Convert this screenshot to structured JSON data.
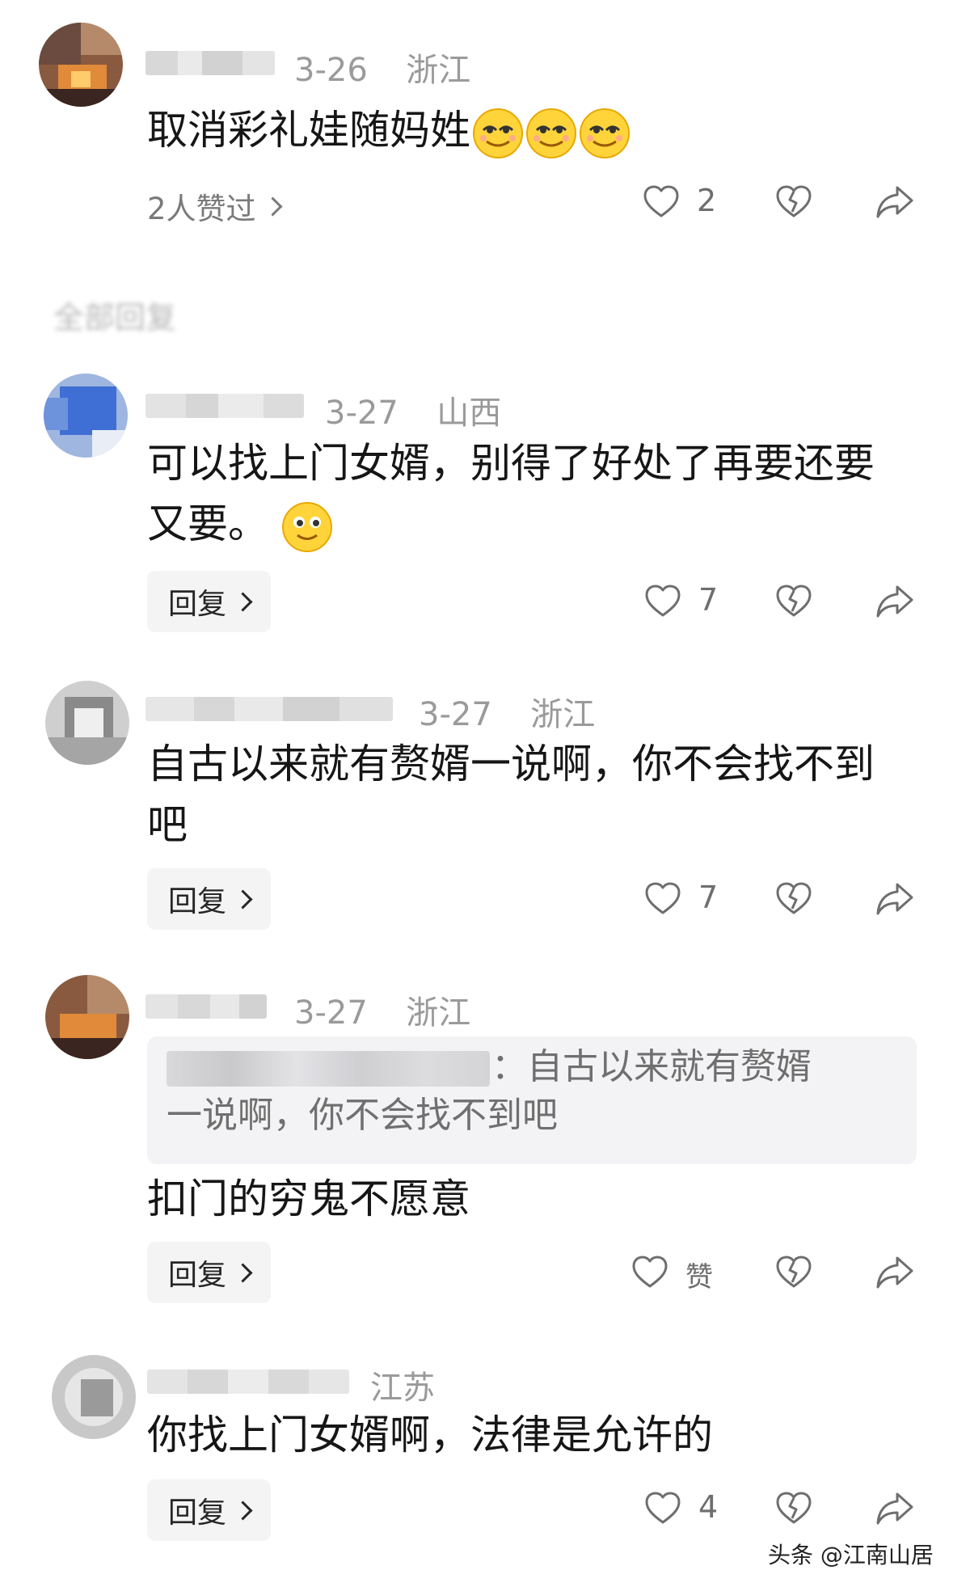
{
  "colors": {
    "text": "#161616",
    "meta": "#9a9a9a",
    "icon": "#6e6e6e",
    "button_bg": "#f4f4f4",
    "quote_bg": "#f3f3f5"
  },
  "main_comment": {
    "date": "3-26",
    "location": "浙江",
    "text": "取消彩礼娃随妈姓",
    "emojis": [
      "smirk-emoji",
      "smirk-emoji",
      "smirk-emoji"
    ],
    "likers_text": "2人赞过",
    "like_count": "2"
  },
  "section": {
    "title": "全部回复"
  },
  "replies": [
    {
      "date": "3-27",
      "location": "山西",
      "text_line1": "可以找上门女婿，别得了好处了再要还要",
      "text_line2": "又要。",
      "emoji": "smile-emoji",
      "reply_label": "回复",
      "like_count": "7"
    },
    {
      "date": "3-27",
      "location": "浙江",
      "text_line1": "自古以来就有赘婿一说啊，你不会找不到",
      "text_line2": "吧",
      "reply_label": "回复",
      "like_count": "7"
    },
    {
      "date": "3-27",
      "location": "浙江",
      "quote_line1": "：自古以来就有赘婿",
      "quote_line2": "一说啊，你不会找不到吧",
      "text_line1": "扣门的穷鬼不愿意",
      "reply_label": "回复",
      "like_count": "赞"
    },
    {
      "date": "",
      "location": "江苏",
      "text_line1": "你找上门女婿啊，法律是允许的",
      "reply_label": "回复",
      "like_count": "4"
    }
  ],
  "watermark": "头条 @江南山居"
}
